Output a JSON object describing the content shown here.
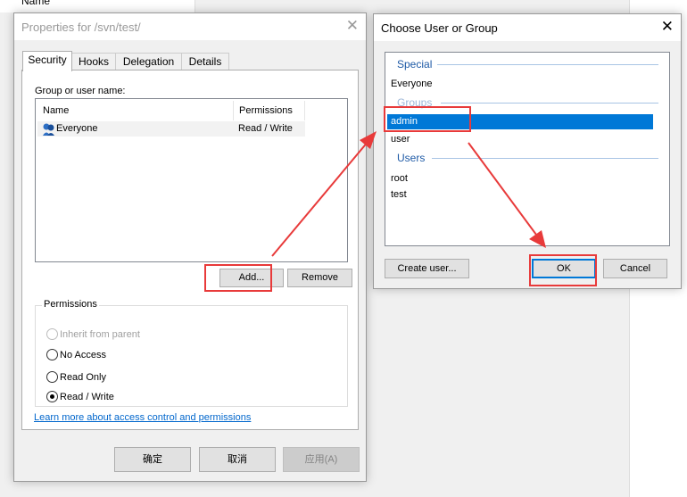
{
  "background": {
    "top_text": "Name"
  },
  "properties": {
    "title": "Properties for /svn/test/",
    "tabs": [
      "Security",
      "Hooks",
      "Delegation",
      "Details"
    ],
    "group_label": "Group or user name:",
    "columns": [
      "Name",
      "Permissions"
    ],
    "rows": [
      {
        "name": "Everyone",
        "permission": "Read / Write"
      }
    ],
    "add_button": "Add...",
    "remove_button": "Remove",
    "permissions_title": "Permissions",
    "options": [
      "Inherit from parent",
      "No Access",
      "Read Only",
      "Read / Write"
    ],
    "selected_option": "Read / Write",
    "learn_more": "Learn more about access control and permissions",
    "ok": "确定",
    "cancel": "取消",
    "apply": "应用(A)"
  },
  "chooser": {
    "title": "Choose User or Group",
    "special_header": "Special",
    "special_items": [
      "Everyone"
    ],
    "groups_header": "Groups",
    "group_items": [
      "admin",
      "user"
    ],
    "selected": "admin",
    "users_header": "Users",
    "user_items": [
      "root",
      "test"
    ],
    "create_user_button": "Create user...",
    "ok_button": "OK",
    "cancel_button": "Cancel"
  },
  "colors": {
    "annotation": "#e83a3a",
    "selection": "#0078d7",
    "section": "#1e5aa6"
  }
}
